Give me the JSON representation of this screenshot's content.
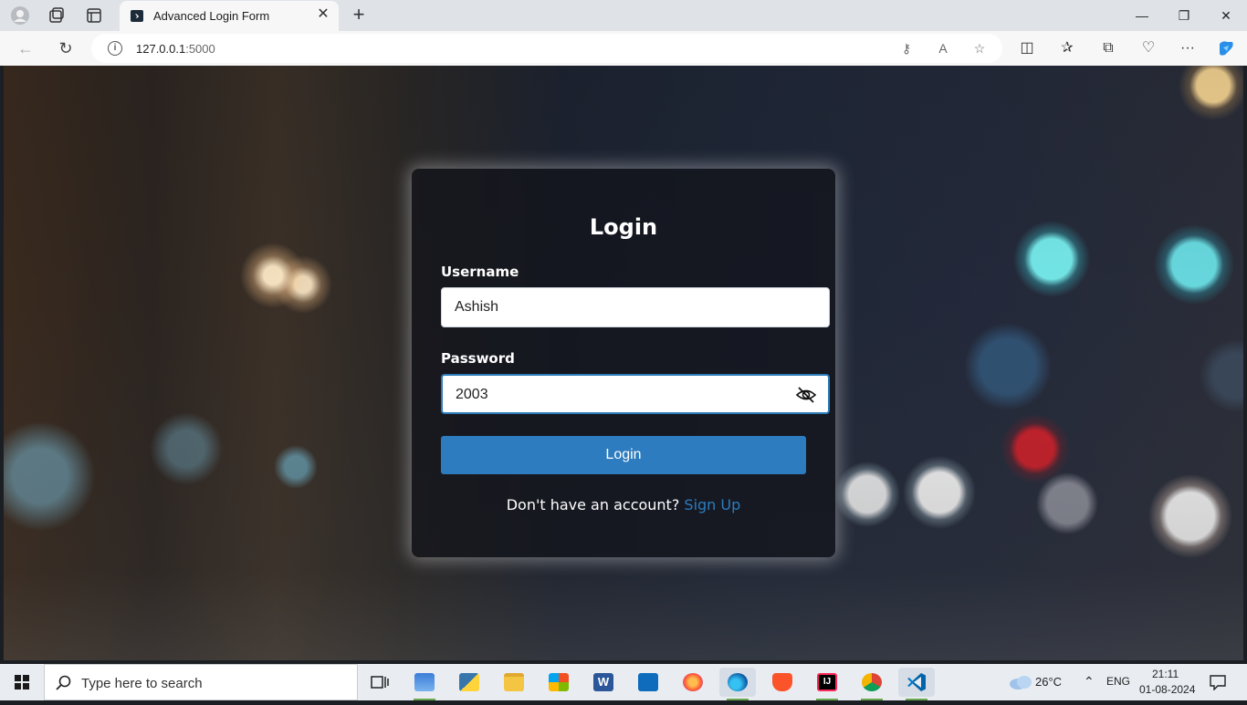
{
  "browser": {
    "tab_title": "Advanced Login Form",
    "url_host": "127.0.0.1",
    "url_port": ":5000"
  },
  "login": {
    "title": "Login",
    "username_label": "Username",
    "username_value": "Ashish",
    "password_label": "Password",
    "password_value": "2003",
    "button_label": "Login",
    "signup_prompt": "Don't have an account?",
    "signup_link": "Sign Up"
  },
  "taskbar": {
    "search_placeholder": "Type here to search",
    "weather": "26°C",
    "language": "ENG",
    "time": "21:11",
    "date": "01-08-2024"
  },
  "colors": {
    "accent": "#2c7cbf",
    "card_bg": "#12141a"
  }
}
